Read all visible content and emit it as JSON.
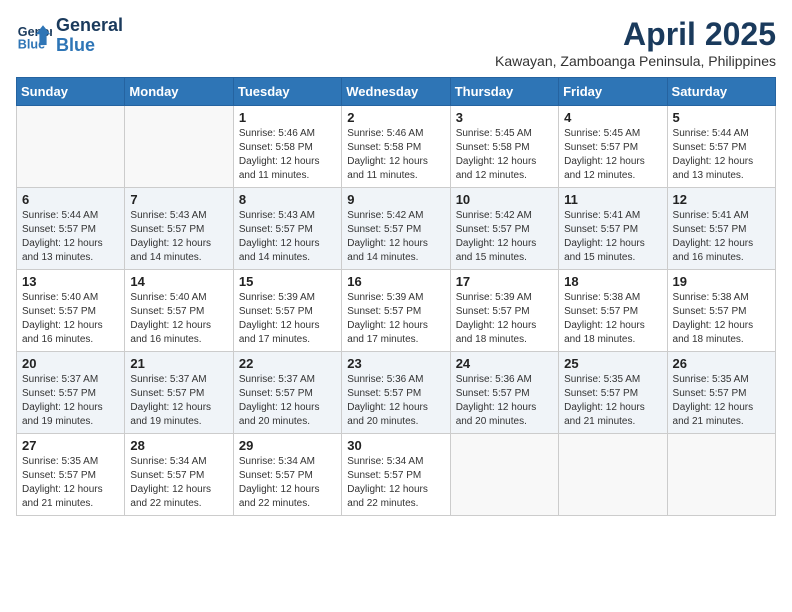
{
  "header": {
    "logo_line1": "General",
    "logo_line2": "Blue",
    "month": "April 2025",
    "location": "Kawayan, Zamboanga Peninsula, Philippines"
  },
  "weekdays": [
    "Sunday",
    "Monday",
    "Tuesday",
    "Wednesday",
    "Thursday",
    "Friday",
    "Saturday"
  ],
  "weeks": [
    [
      {
        "day": "",
        "info": ""
      },
      {
        "day": "",
        "info": ""
      },
      {
        "day": "1",
        "sunrise": "5:46 AM",
        "sunset": "5:58 PM",
        "daylight": "12 hours and 11 minutes."
      },
      {
        "day": "2",
        "sunrise": "5:46 AM",
        "sunset": "5:58 PM",
        "daylight": "12 hours and 11 minutes."
      },
      {
        "day": "3",
        "sunrise": "5:45 AM",
        "sunset": "5:58 PM",
        "daylight": "12 hours and 12 minutes."
      },
      {
        "day": "4",
        "sunrise": "5:45 AM",
        "sunset": "5:57 PM",
        "daylight": "12 hours and 12 minutes."
      },
      {
        "day": "5",
        "sunrise": "5:44 AM",
        "sunset": "5:57 PM",
        "daylight": "12 hours and 13 minutes."
      }
    ],
    [
      {
        "day": "6",
        "sunrise": "5:44 AM",
        "sunset": "5:57 PM",
        "daylight": "12 hours and 13 minutes."
      },
      {
        "day": "7",
        "sunrise": "5:43 AM",
        "sunset": "5:57 PM",
        "daylight": "12 hours and 14 minutes."
      },
      {
        "day": "8",
        "sunrise": "5:43 AM",
        "sunset": "5:57 PM",
        "daylight": "12 hours and 14 minutes."
      },
      {
        "day": "9",
        "sunrise": "5:42 AM",
        "sunset": "5:57 PM",
        "daylight": "12 hours and 14 minutes."
      },
      {
        "day": "10",
        "sunrise": "5:42 AM",
        "sunset": "5:57 PM",
        "daylight": "12 hours and 15 minutes."
      },
      {
        "day": "11",
        "sunrise": "5:41 AM",
        "sunset": "5:57 PM",
        "daylight": "12 hours and 15 minutes."
      },
      {
        "day": "12",
        "sunrise": "5:41 AM",
        "sunset": "5:57 PM",
        "daylight": "12 hours and 16 minutes."
      }
    ],
    [
      {
        "day": "13",
        "sunrise": "5:40 AM",
        "sunset": "5:57 PM",
        "daylight": "12 hours and 16 minutes."
      },
      {
        "day": "14",
        "sunrise": "5:40 AM",
        "sunset": "5:57 PM",
        "daylight": "12 hours and 16 minutes."
      },
      {
        "day": "15",
        "sunrise": "5:39 AM",
        "sunset": "5:57 PM",
        "daylight": "12 hours and 17 minutes."
      },
      {
        "day": "16",
        "sunrise": "5:39 AM",
        "sunset": "5:57 PM",
        "daylight": "12 hours and 17 minutes."
      },
      {
        "day": "17",
        "sunrise": "5:39 AM",
        "sunset": "5:57 PM",
        "daylight": "12 hours and 18 minutes."
      },
      {
        "day": "18",
        "sunrise": "5:38 AM",
        "sunset": "5:57 PM",
        "daylight": "12 hours and 18 minutes."
      },
      {
        "day": "19",
        "sunrise": "5:38 AM",
        "sunset": "5:57 PM",
        "daylight": "12 hours and 18 minutes."
      }
    ],
    [
      {
        "day": "20",
        "sunrise": "5:37 AM",
        "sunset": "5:57 PM",
        "daylight": "12 hours and 19 minutes."
      },
      {
        "day": "21",
        "sunrise": "5:37 AM",
        "sunset": "5:57 PM",
        "daylight": "12 hours and 19 minutes."
      },
      {
        "day": "22",
        "sunrise": "5:37 AM",
        "sunset": "5:57 PM",
        "daylight": "12 hours and 20 minutes."
      },
      {
        "day": "23",
        "sunrise": "5:36 AM",
        "sunset": "5:57 PM",
        "daylight": "12 hours and 20 minutes."
      },
      {
        "day": "24",
        "sunrise": "5:36 AM",
        "sunset": "5:57 PM",
        "daylight": "12 hours and 20 minutes."
      },
      {
        "day": "25",
        "sunrise": "5:35 AM",
        "sunset": "5:57 PM",
        "daylight": "12 hours and 21 minutes."
      },
      {
        "day": "26",
        "sunrise": "5:35 AM",
        "sunset": "5:57 PM",
        "daylight": "12 hours and 21 minutes."
      }
    ],
    [
      {
        "day": "27",
        "sunrise": "5:35 AM",
        "sunset": "5:57 PM",
        "daylight": "12 hours and 21 minutes."
      },
      {
        "day": "28",
        "sunrise": "5:34 AM",
        "sunset": "5:57 PM",
        "daylight": "12 hours and 22 minutes."
      },
      {
        "day": "29",
        "sunrise": "5:34 AM",
        "sunset": "5:57 PM",
        "daylight": "12 hours and 22 minutes."
      },
      {
        "day": "30",
        "sunrise": "5:34 AM",
        "sunset": "5:57 PM",
        "daylight": "12 hours and 22 minutes."
      },
      {
        "day": "",
        "info": ""
      },
      {
        "day": "",
        "info": ""
      },
      {
        "day": "",
        "info": ""
      }
    ]
  ]
}
